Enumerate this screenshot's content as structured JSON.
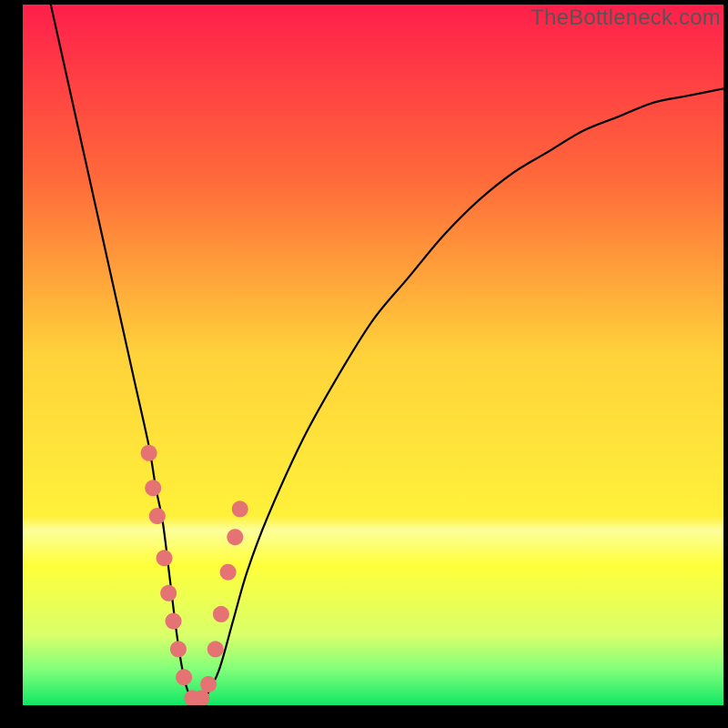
{
  "watermark": "TheBottleneck.com",
  "chart_data": {
    "type": "line",
    "title": "",
    "xlabel": "",
    "ylabel": "",
    "xlim": [
      0,
      100
    ],
    "ylim": [
      0,
      100
    ],
    "background_gradient_stops": [
      {
        "offset": 0.0,
        "color": "#ff1f4b"
      },
      {
        "offset": 0.25,
        "color": "#ff6a3a"
      },
      {
        "offset": 0.5,
        "color": "#ffd23a"
      },
      {
        "offset": 0.73,
        "color": "#fff13a"
      },
      {
        "offset": 0.75,
        "color": "#fcff9a"
      },
      {
        "offset": 0.8,
        "color": "#ffff3a"
      },
      {
        "offset": 0.9,
        "color": "#d9ff6a"
      },
      {
        "offset": 0.95,
        "color": "#7fff7a"
      },
      {
        "offset": 1.0,
        "color": "#10e765"
      }
    ],
    "series": [
      {
        "name": "bottleneck-curve",
        "color": "#000000",
        "x": [
          4,
          6,
          8,
          10,
          12,
          14,
          16,
          18,
          19,
          20,
          21,
          22,
          23,
          24,
          25,
          26,
          28,
          30,
          32,
          35,
          40,
          45,
          50,
          55,
          60,
          65,
          70,
          75,
          80,
          85,
          90,
          95,
          100
        ],
        "y": [
          100,
          91,
          82,
          73,
          64,
          55,
          46,
          37,
          31,
          26,
          18,
          10,
          4,
          1,
          0,
          1,
          5,
          12,
          19,
          27,
          38,
          47,
          55,
          61,
          67,
          72,
          76,
          79,
          82,
          84,
          86,
          87,
          88
        ]
      }
    ],
    "scatter": {
      "name": "marker-points",
      "color": "#e57373",
      "radius": 9,
      "points": [
        {
          "x": 18.0,
          "y": 36
        },
        {
          "x": 18.6,
          "y": 31
        },
        {
          "x": 19.2,
          "y": 27
        },
        {
          "x": 20.2,
          "y": 21
        },
        {
          "x": 20.8,
          "y": 16
        },
        {
          "x": 21.5,
          "y": 12
        },
        {
          "x": 22.2,
          "y": 8
        },
        {
          "x": 23.0,
          "y": 4
        },
        {
          "x": 24.2,
          "y": 1
        },
        {
          "x": 25.5,
          "y": 1
        },
        {
          "x": 26.5,
          "y": 3
        },
        {
          "x": 27.5,
          "y": 8
        },
        {
          "x": 28.3,
          "y": 13
        },
        {
          "x": 29.3,
          "y": 19
        },
        {
          "x": 30.3,
          "y": 24
        },
        {
          "x": 31.0,
          "y": 28
        }
      ]
    }
  }
}
